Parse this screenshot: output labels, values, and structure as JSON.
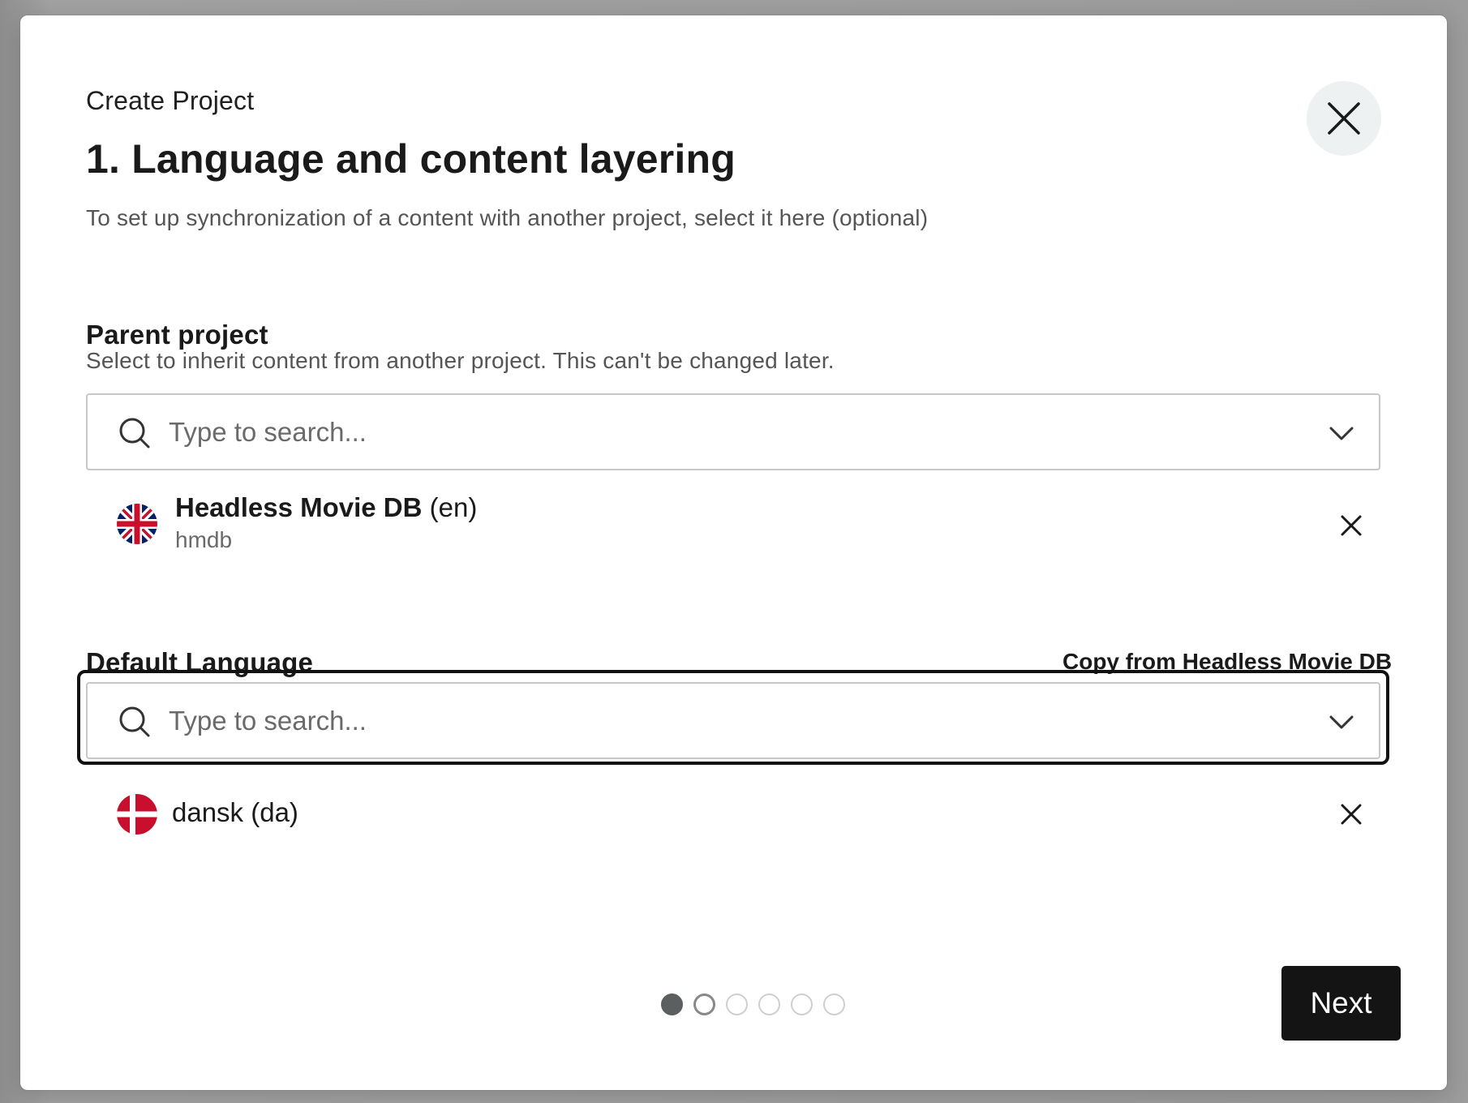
{
  "modal": {
    "breadcrumb": "Create Project",
    "title": "1. Language and content layering",
    "subtitle": "To set up synchronization of a content with another project, select it here (optional)",
    "close_icon": "close-icon"
  },
  "parent_project": {
    "label": "Parent project",
    "helper": "Select to inherit content from another project. This can't be changed later.",
    "search_placeholder": "Type to search...",
    "selected": {
      "name": "Headless Movie DB",
      "lang": "(en)",
      "slug": "hmdb",
      "flag_icon": "uk-flag-icon"
    }
  },
  "default_language": {
    "label": "Default Language",
    "copy_link": "Copy from Headless Movie DB",
    "search_placeholder": "Type to search...",
    "selected": {
      "name": "dansk (da)",
      "flag_icon": "denmark-flag-icon"
    }
  },
  "stepper": {
    "total_steps": 6,
    "current_step": 1
  },
  "footer": {
    "next_label": "Next"
  },
  "colors": {
    "primary_button": "#141414",
    "overlay": "#9a9a9a",
    "close_bg": "#eef1f1"
  }
}
